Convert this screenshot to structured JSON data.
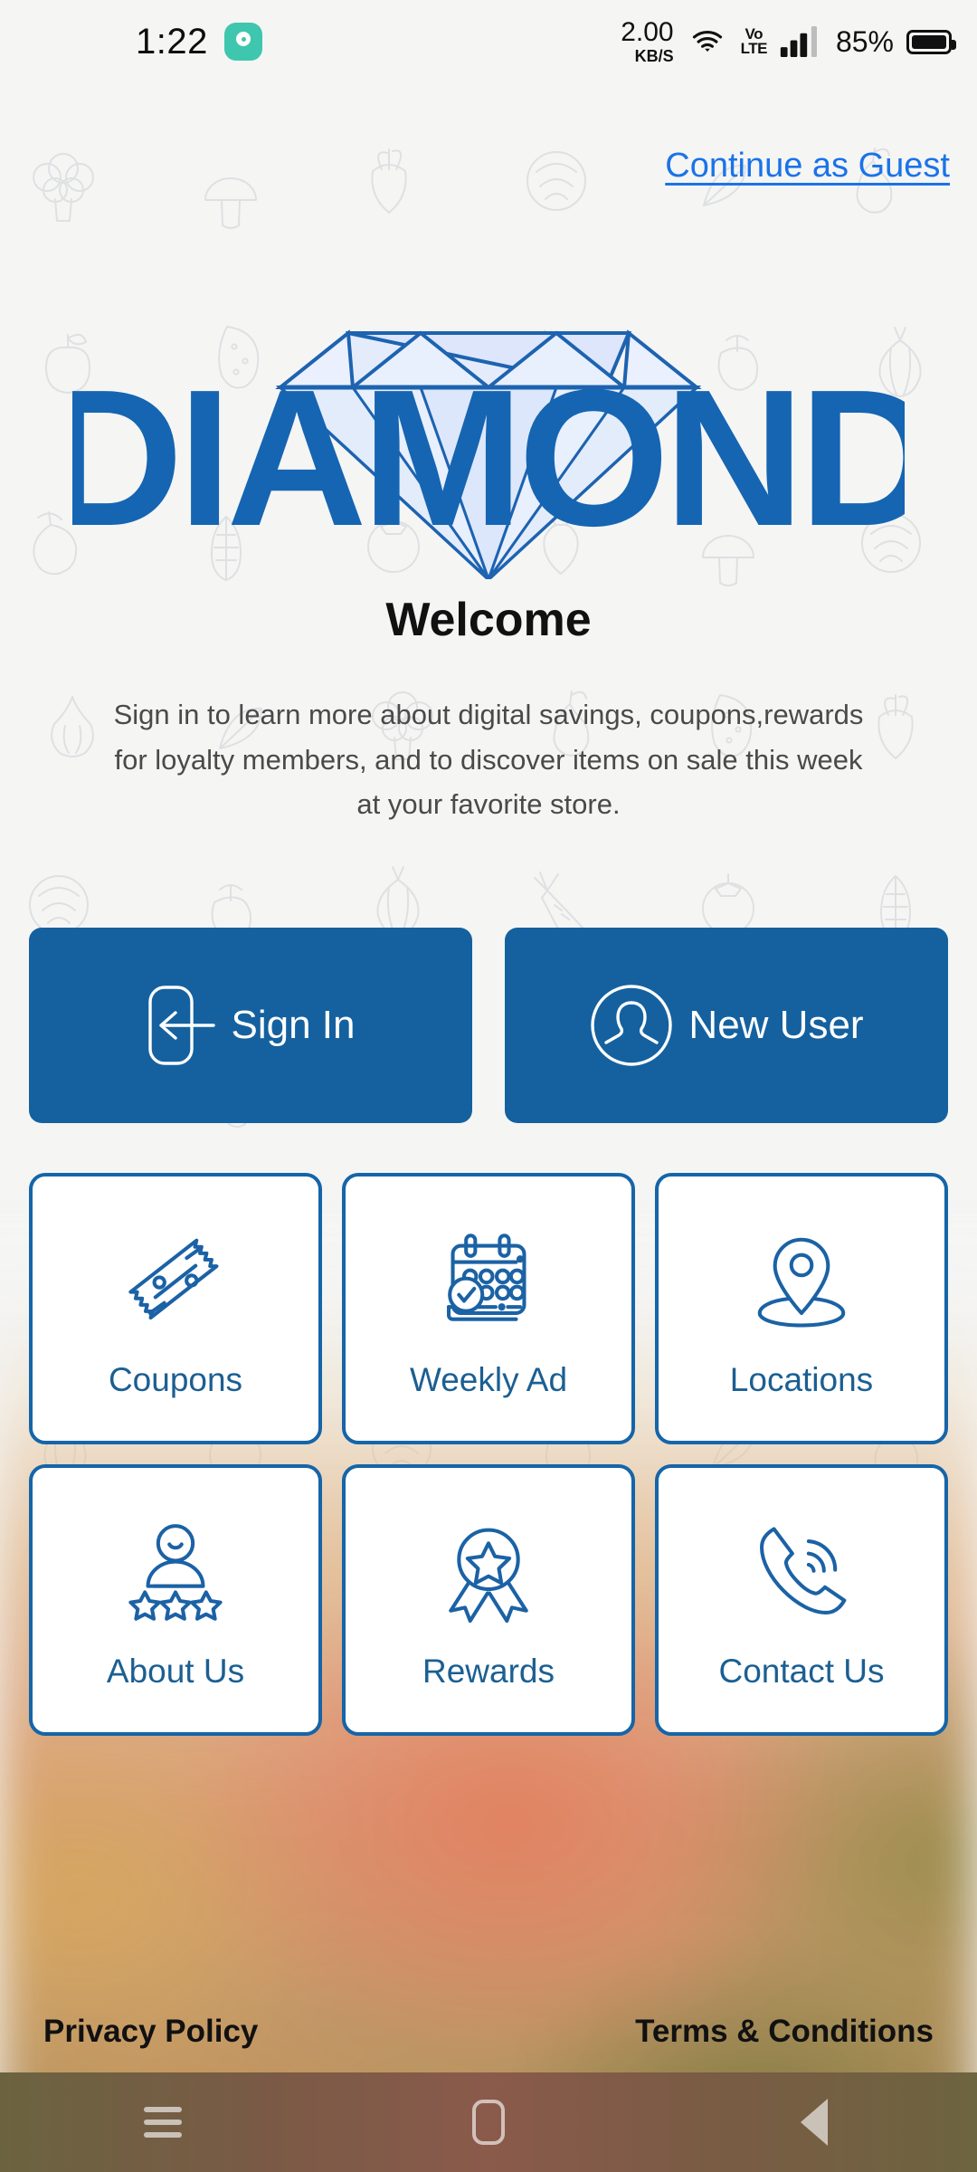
{
  "status_bar": {
    "time": "1:22",
    "app_icon": "notification-app-icon",
    "net_speed_value": "2.00",
    "net_speed_unit": "KB/S",
    "wifi_icon": "wifi-icon",
    "volte_line1": "Vo",
    "volte_line2": "LTE",
    "signal_icon": "cellular-signal-icon",
    "battery_percent": "85%",
    "battery_icon": "battery-icon"
  },
  "header": {
    "guest_link": "Continue as Guest"
  },
  "logo": {
    "brand": "DIAMOND",
    "gem_icon": "diamond-gem-icon"
  },
  "main": {
    "title": "Welcome",
    "description": "Sign in to learn more about digital savings, coupons,rewards for loyalty members, and to discover items on sale this week at your favorite store."
  },
  "primary_buttons": [
    {
      "label": "Sign In",
      "icon": "sign-in-door-icon"
    },
    {
      "label": "New User",
      "icon": "user-circle-icon"
    }
  ],
  "tiles": [
    {
      "label": "Coupons",
      "icon": "coupon-ticket-icon"
    },
    {
      "label": "Weekly Ad",
      "icon": "calendar-check-icon"
    },
    {
      "label": "Locations",
      "icon": "map-pin-icon"
    },
    {
      "label": "About Us",
      "icon": "person-stars-icon"
    },
    {
      "label": "Rewards",
      "icon": "award-ribbon-icon"
    },
    {
      "label": "Contact Us",
      "icon": "phone-call-icon"
    }
  ],
  "footer": {
    "privacy": "Privacy Policy",
    "terms": "Terms & Conditions"
  },
  "nav_bar": {
    "recents": "recents-icon",
    "home": "home-icon",
    "back": "back-icon"
  },
  "colors": {
    "brand_blue": "#15619f",
    "tile_border": "#1565a8",
    "tile_label": "#1b5f92",
    "link_blue": "#1a73e8"
  }
}
